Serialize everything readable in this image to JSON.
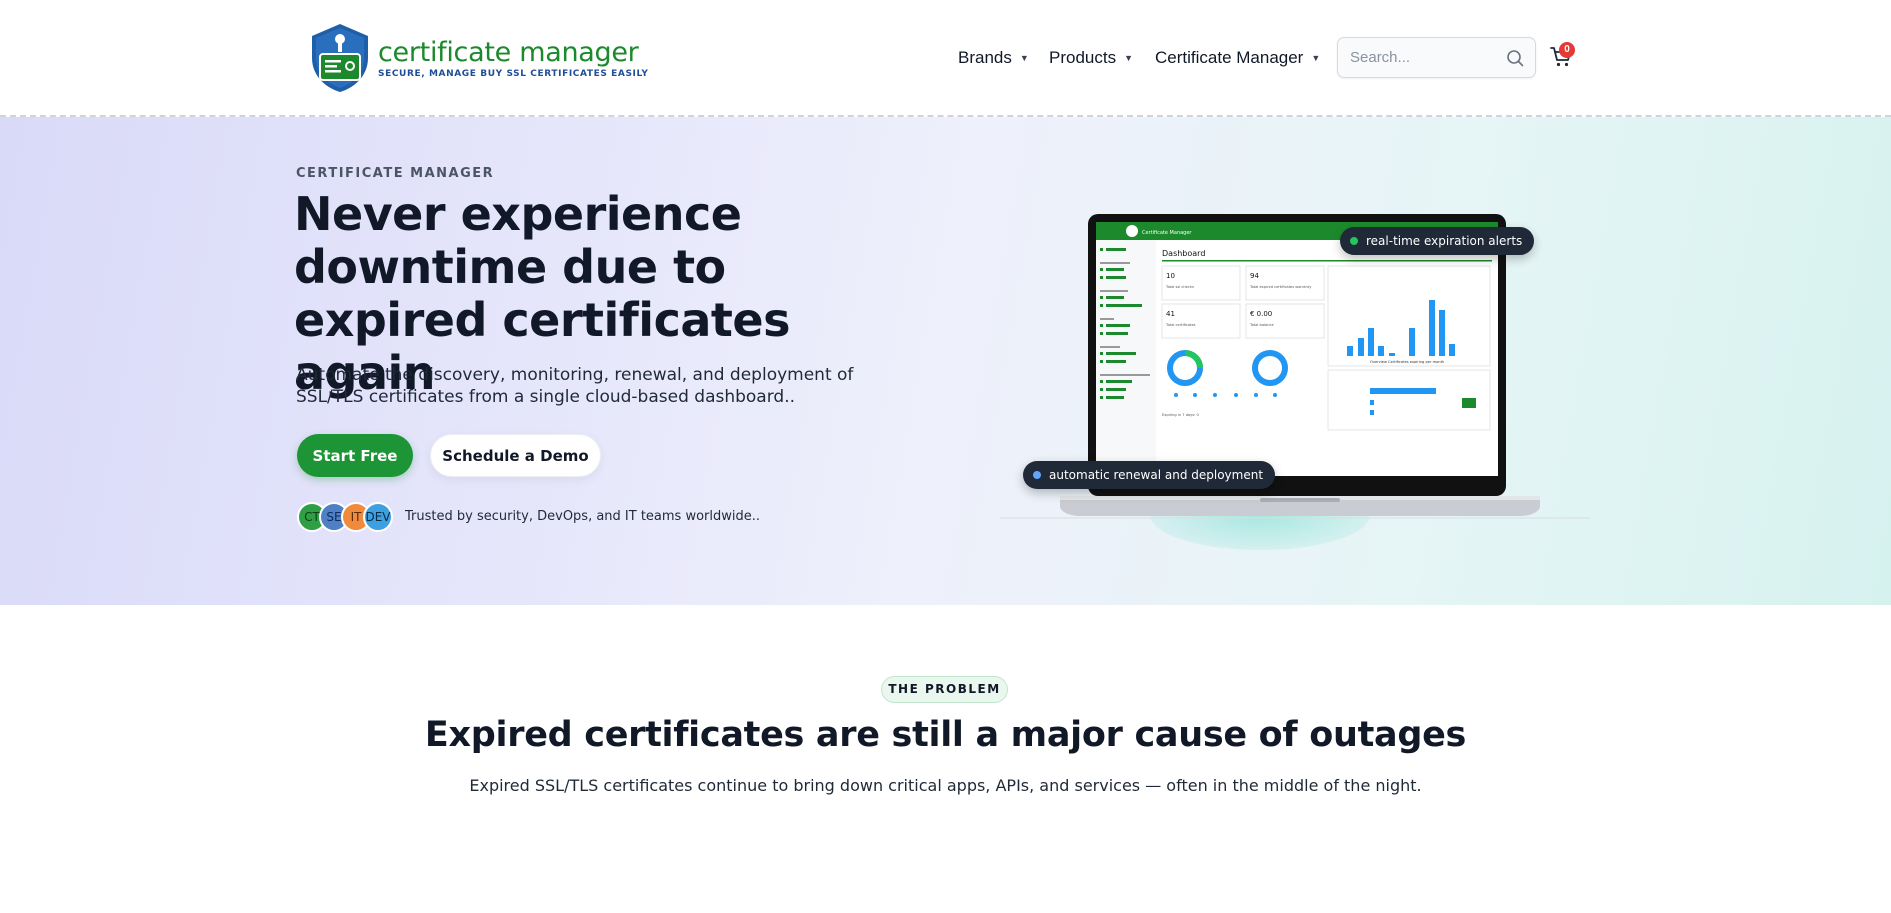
{
  "header": {
    "logo_title": "certificate manager",
    "logo_tagline": "SECURE, MANAGE BUY SSL CERTIFICATES EASILY",
    "nav": [
      {
        "label": "Brands"
      },
      {
        "label": "Products"
      },
      {
        "label": "Certificate Manager"
      }
    ],
    "search_placeholder": "Search...",
    "cart_count": "0"
  },
  "hero": {
    "eyebrow": "CERTIFICATE MANAGER",
    "title": "Never experience downtime due to expired certificates again",
    "description": "Automate the discovery, monitoring, renewal, and deployment of SSL/TLS certificates from a single cloud-based dashboard..",
    "primary_cta": "Start Free",
    "secondary_cta": "Schedule a Demo",
    "avatars": [
      "CT",
      "SE",
      "IT",
      "DEV"
    ],
    "trusted_text": "Trusted by security, DevOps, and IT teams worldwide..",
    "pill_top": "real-time expiration alerts",
    "pill_bottom": "automatic renewal and deployment"
  },
  "dashboard": {
    "app_name": "Certificate Manager",
    "heading": "Dashboard",
    "stats": [
      {
        "value": "10",
        "label": "Total ssl checks"
      },
      {
        "value": "94",
        "label": "Total expired certificates warranty"
      },
      {
        "value": "41",
        "label": "Total certificates"
      },
      {
        "value": "€ 0.00",
        "label": "Total balance"
      }
    ],
    "chart_caption": "Overview Certificates expiring per month",
    "expiring_text": "Expiring in 7 days: 0"
  },
  "problem": {
    "badge": "THE PROBLEM",
    "title": "Expired certificates are still a major cause of outages",
    "description": "Expired SSL/TLS certificates continue to bring down critical apps, APIs, and services — often in the middle of the night."
  },
  "colors": {
    "brand_green": "#1d9436",
    "brand_blue": "#1f5fa8",
    "dark": "#111827",
    "badge_red": "#e53935"
  }
}
